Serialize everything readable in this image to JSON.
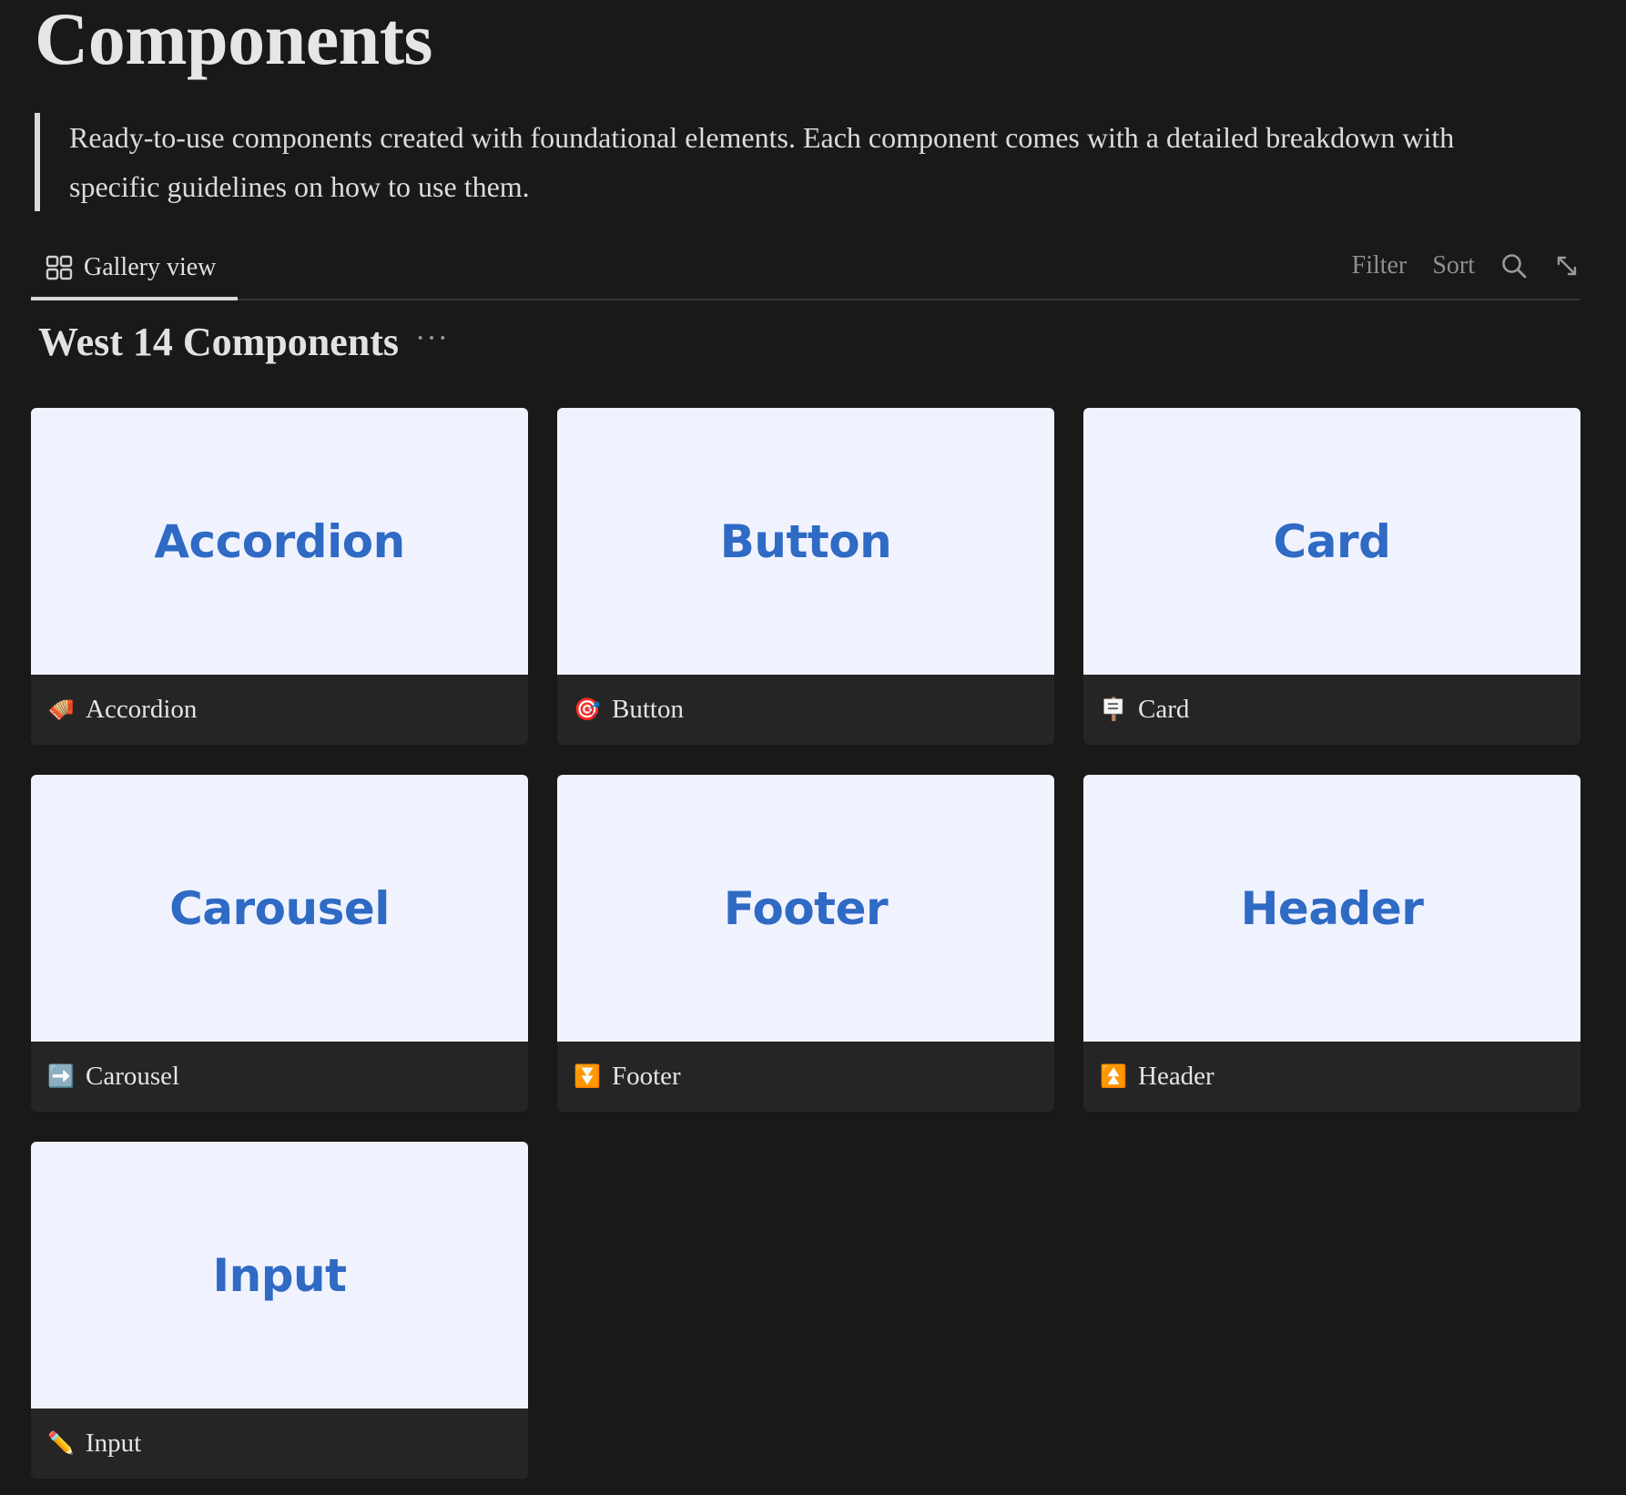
{
  "page": {
    "title": "Components",
    "description": "Ready-to-use components created with foundational elements. Each component comes with a detailed breakdown with specific guidelines on how to use them."
  },
  "view_bar": {
    "active_tab": {
      "icon": "gallery-grid-icon",
      "label": "Gallery view"
    },
    "filter_label": "Filter",
    "sort_label": "Sort",
    "search_icon": "search-icon",
    "expand_icon": "expand-icon"
  },
  "database": {
    "title": "West 14 Components",
    "more": "···"
  },
  "cards": [
    {
      "cover": "Accordion",
      "emoji": "🪗",
      "emoji_name": "accordion-icon",
      "label": "Accordion"
    },
    {
      "cover": "Button",
      "emoji": "🎯",
      "emoji_name": "target-icon",
      "label": "Button"
    },
    {
      "cover": "Card",
      "emoji": "🪧",
      "emoji_name": "placard-icon",
      "label": "Card"
    },
    {
      "cover": "Carousel",
      "emoji": "➡️",
      "emoji_name": "arrow-right-icon",
      "label": "Carousel"
    },
    {
      "cover": "Footer",
      "emoji": "⏬",
      "emoji_name": "double-down-icon",
      "label": "Footer"
    },
    {
      "cover": "Header",
      "emoji": "⏫",
      "emoji_name": "double-up-icon",
      "label": "Header"
    },
    {
      "cover": "Input",
      "emoji": "✏️",
      "emoji_name": "pencil-icon",
      "label": "Input"
    }
  ],
  "colors": {
    "background": "#191919",
    "card_background": "#252525",
    "cover_background": "#f0f3fe",
    "cover_text": "#2f6ac4"
  }
}
